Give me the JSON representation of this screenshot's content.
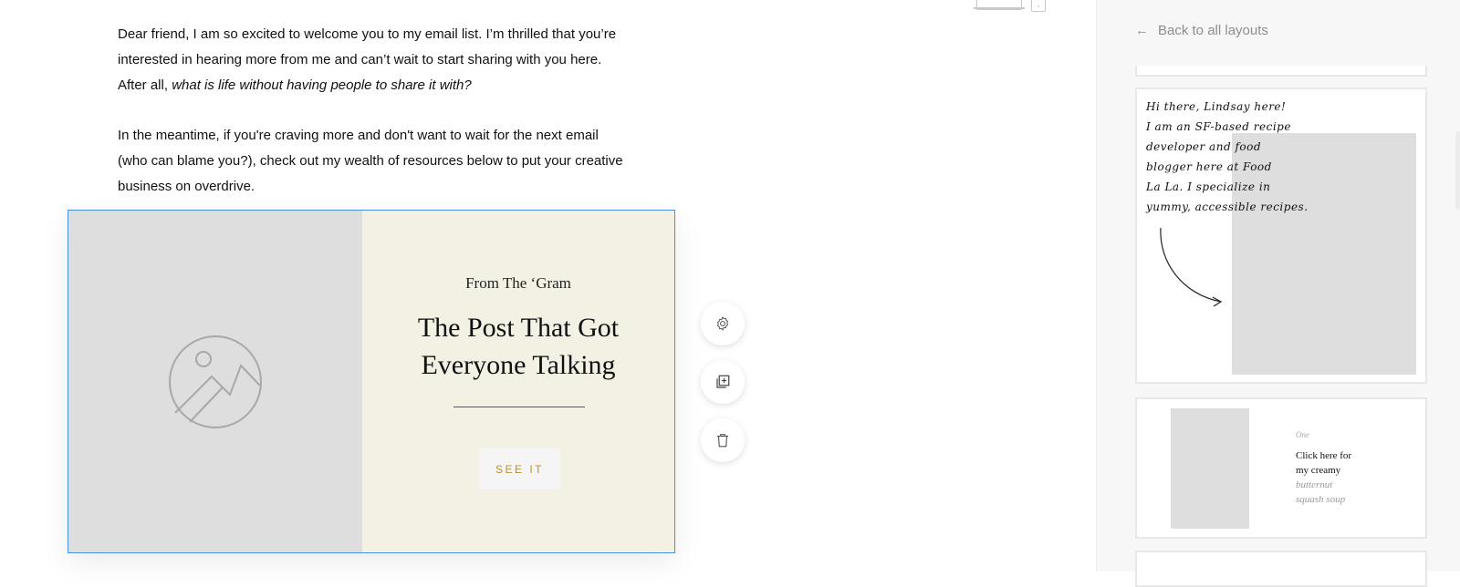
{
  "email": {
    "para1_start": "Dear friend, I am so excited to welcome you to my email list. I’m thrilled that you’re interested in hearing more from me and can’t wait to start sharing with you here. After all, ",
    "para1_italic": "what is life without having people to share it with?",
    "para2": "In the meantime, if you're craving more and don't want to wait for the next email (who can blame you?), check out my wealth of resources below to put your creative business on overdrive.",
    "block": {
      "kicker": "From The ‘Gram",
      "heading": "The Post That Got Everyone Talking",
      "button_label": "SEE IT",
      "image_icon": "image-placeholder-icon"
    }
  },
  "toolbar": {
    "icons": [
      "gear-icon",
      "duplicate-icon",
      "trash-icon"
    ]
  },
  "panel": {
    "back_label": "Back to all layouts",
    "card1": {
      "handwritten": "Hi there, Lindsay here!\nI am an SF-based recipe\ndeveloper and food\nblogger here at Food\nLa La. I specialize in\nyummy, accessible recipes."
    },
    "card2": {
      "eyebrow": "One",
      "line1": "Click here for",
      "line2": "my creamy",
      "line3": "butternut",
      "line4": "squash soup"
    }
  },
  "colors": {
    "selection": "#4a90e2",
    "block_text_bg": "#f3f1e4",
    "placeholder": "#dedede",
    "cta_text": "#b89030",
    "panel_bg": "#f7f7f7"
  }
}
